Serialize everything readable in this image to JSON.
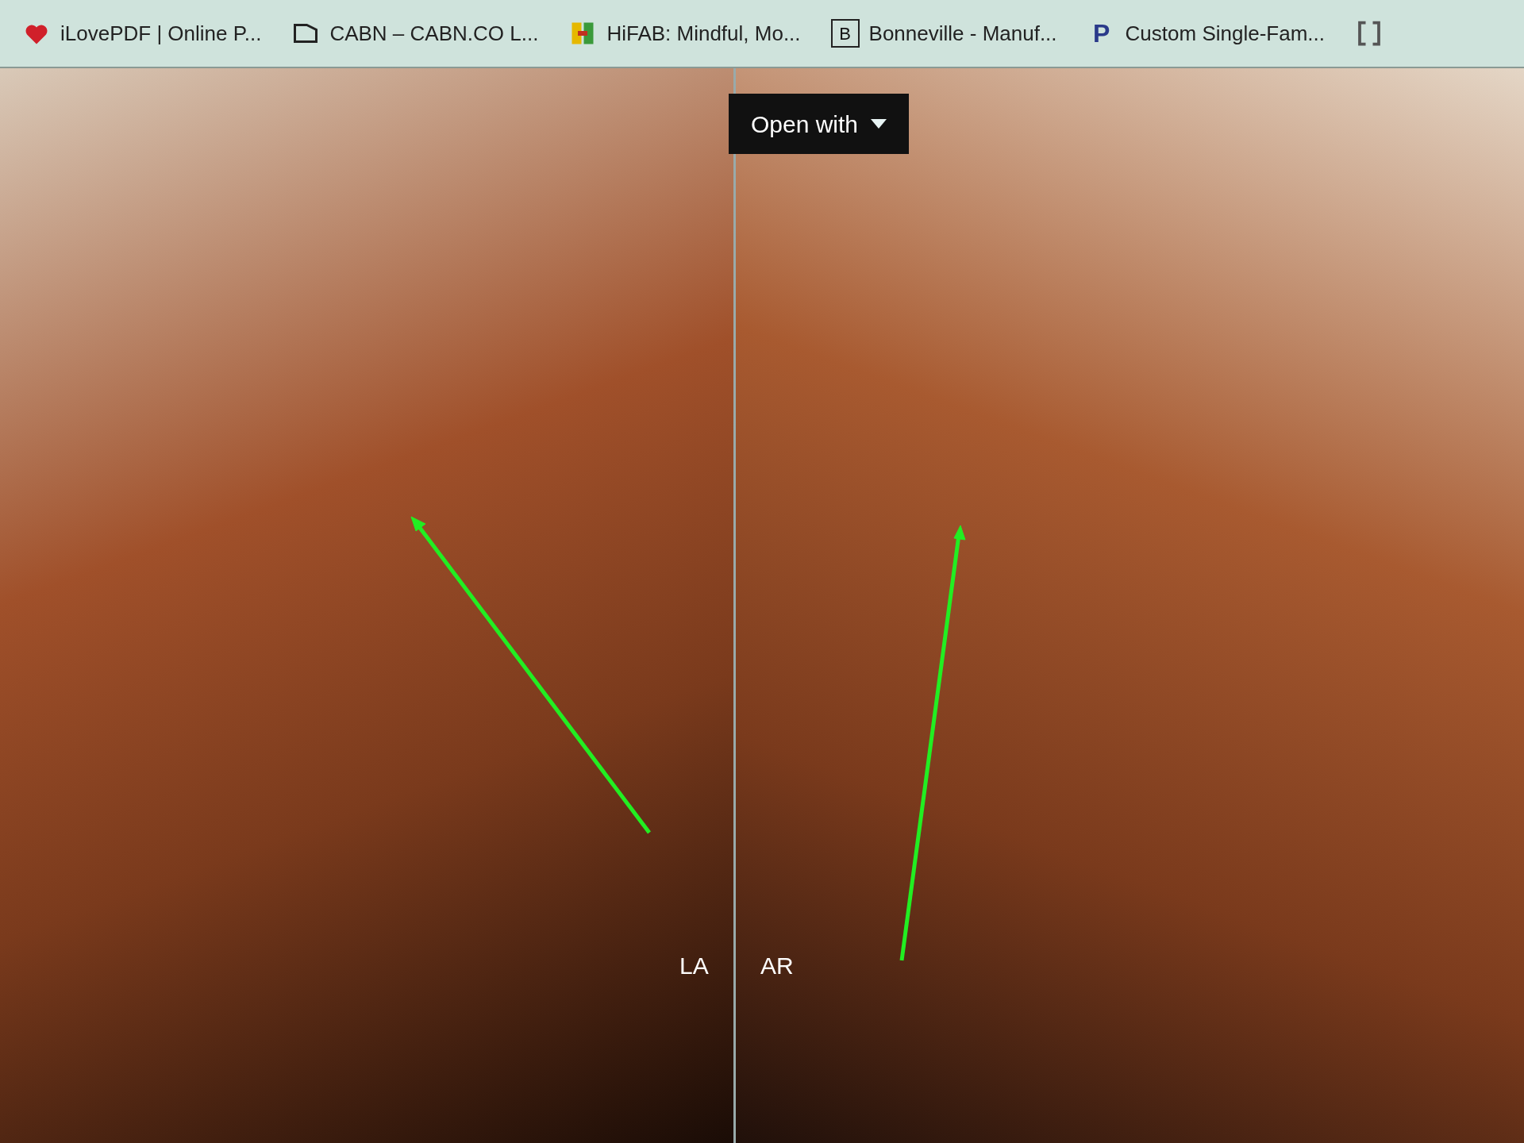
{
  "bookmarks_bar": {
    "items": [
      {
        "kind": "heart",
        "label": "iLovePDF | Online P..."
      },
      {
        "kind": "outline",
        "label": "CABN – CABN.CO L..."
      },
      {
        "kind": "tiles",
        "label": "HiFAB: Mindful, Mo..."
      },
      {
        "kind": "letter-box",
        "icon_letter": "B",
        "label": "Bonneville - Manuf..."
      },
      {
        "kind": "letter",
        "icon_letter": "P",
        "label": "Custom Single-Fam..."
      },
      {
        "kind": "bracket"
      }
    ]
  },
  "viewer": {
    "open_with_button": {
      "label": "Open with"
    },
    "panels": [
      {
        "orientation_label": "LA"
      },
      {
        "orientation_label": "AR"
      }
    ]
  }
}
